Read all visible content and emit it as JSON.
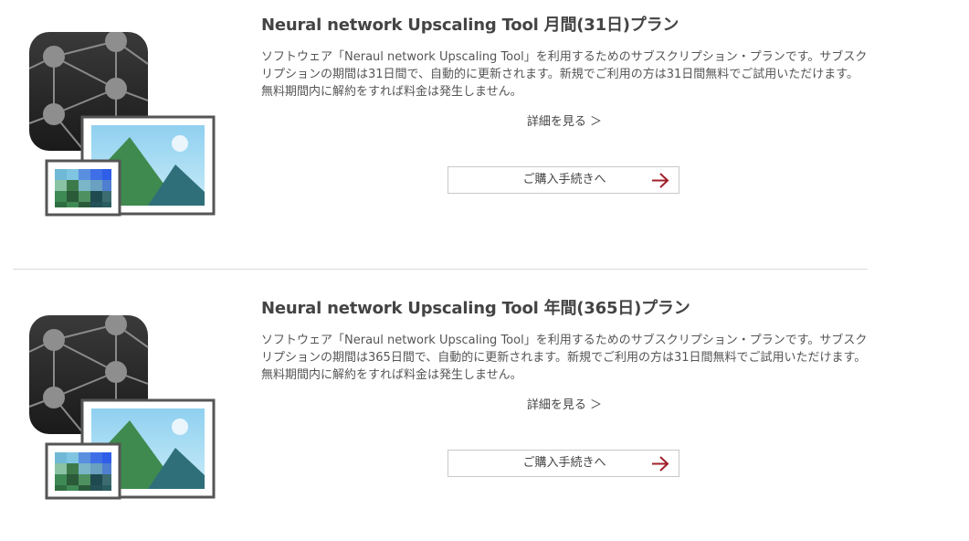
{
  "plans": [
    {
      "title": "Neural network Upscaling Tool 月間(31日)プラン",
      "description": "ソフトウェア「Neraul network Upscaling Tool」を利用するためのサブスクリプション・プランです。サブスクリプションの期間は31日間で、自動的に更新されます。新規でご利用の方は31日間無料でご試用いただけます。無料期間内に解約をすれば料金は発生しません。",
      "detail_link": "詳細を見る ＞",
      "buy_button": "ご購入手続きへ",
      "icon": "neural-network-upscaling-app-icon",
      "button_arrow_icon": "arrow-right-icon"
    },
    {
      "title": "Neural network Upscaling Tool 年間(365日)プラン",
      "description": "ソフトウェア「Neraul network Upscaling Tool」を利用するためのサブスクリプション・プランです。サブスクリプションの期間は365日間で、自動的に更新されます。新規でご利用の方は31日間無料でご試用いただけます。無料期間内に解約をすれば料金は発生しません。",
      "detail_link": "詳細を見る ＞",
      "buy_button": "ご購入手続きへ",
      "icon": "neural-network-upscaling-app-icon",
      "button_arrow_icon": "arrow-right-icon"
    }
  ],
  "colors": {
    "title": "#444444",
    "text": "#555555",
    "arrow": "#a0202a",
    "button_border": "#c8c8c8",
    "divider": "#d9d9d9"
  }
}
